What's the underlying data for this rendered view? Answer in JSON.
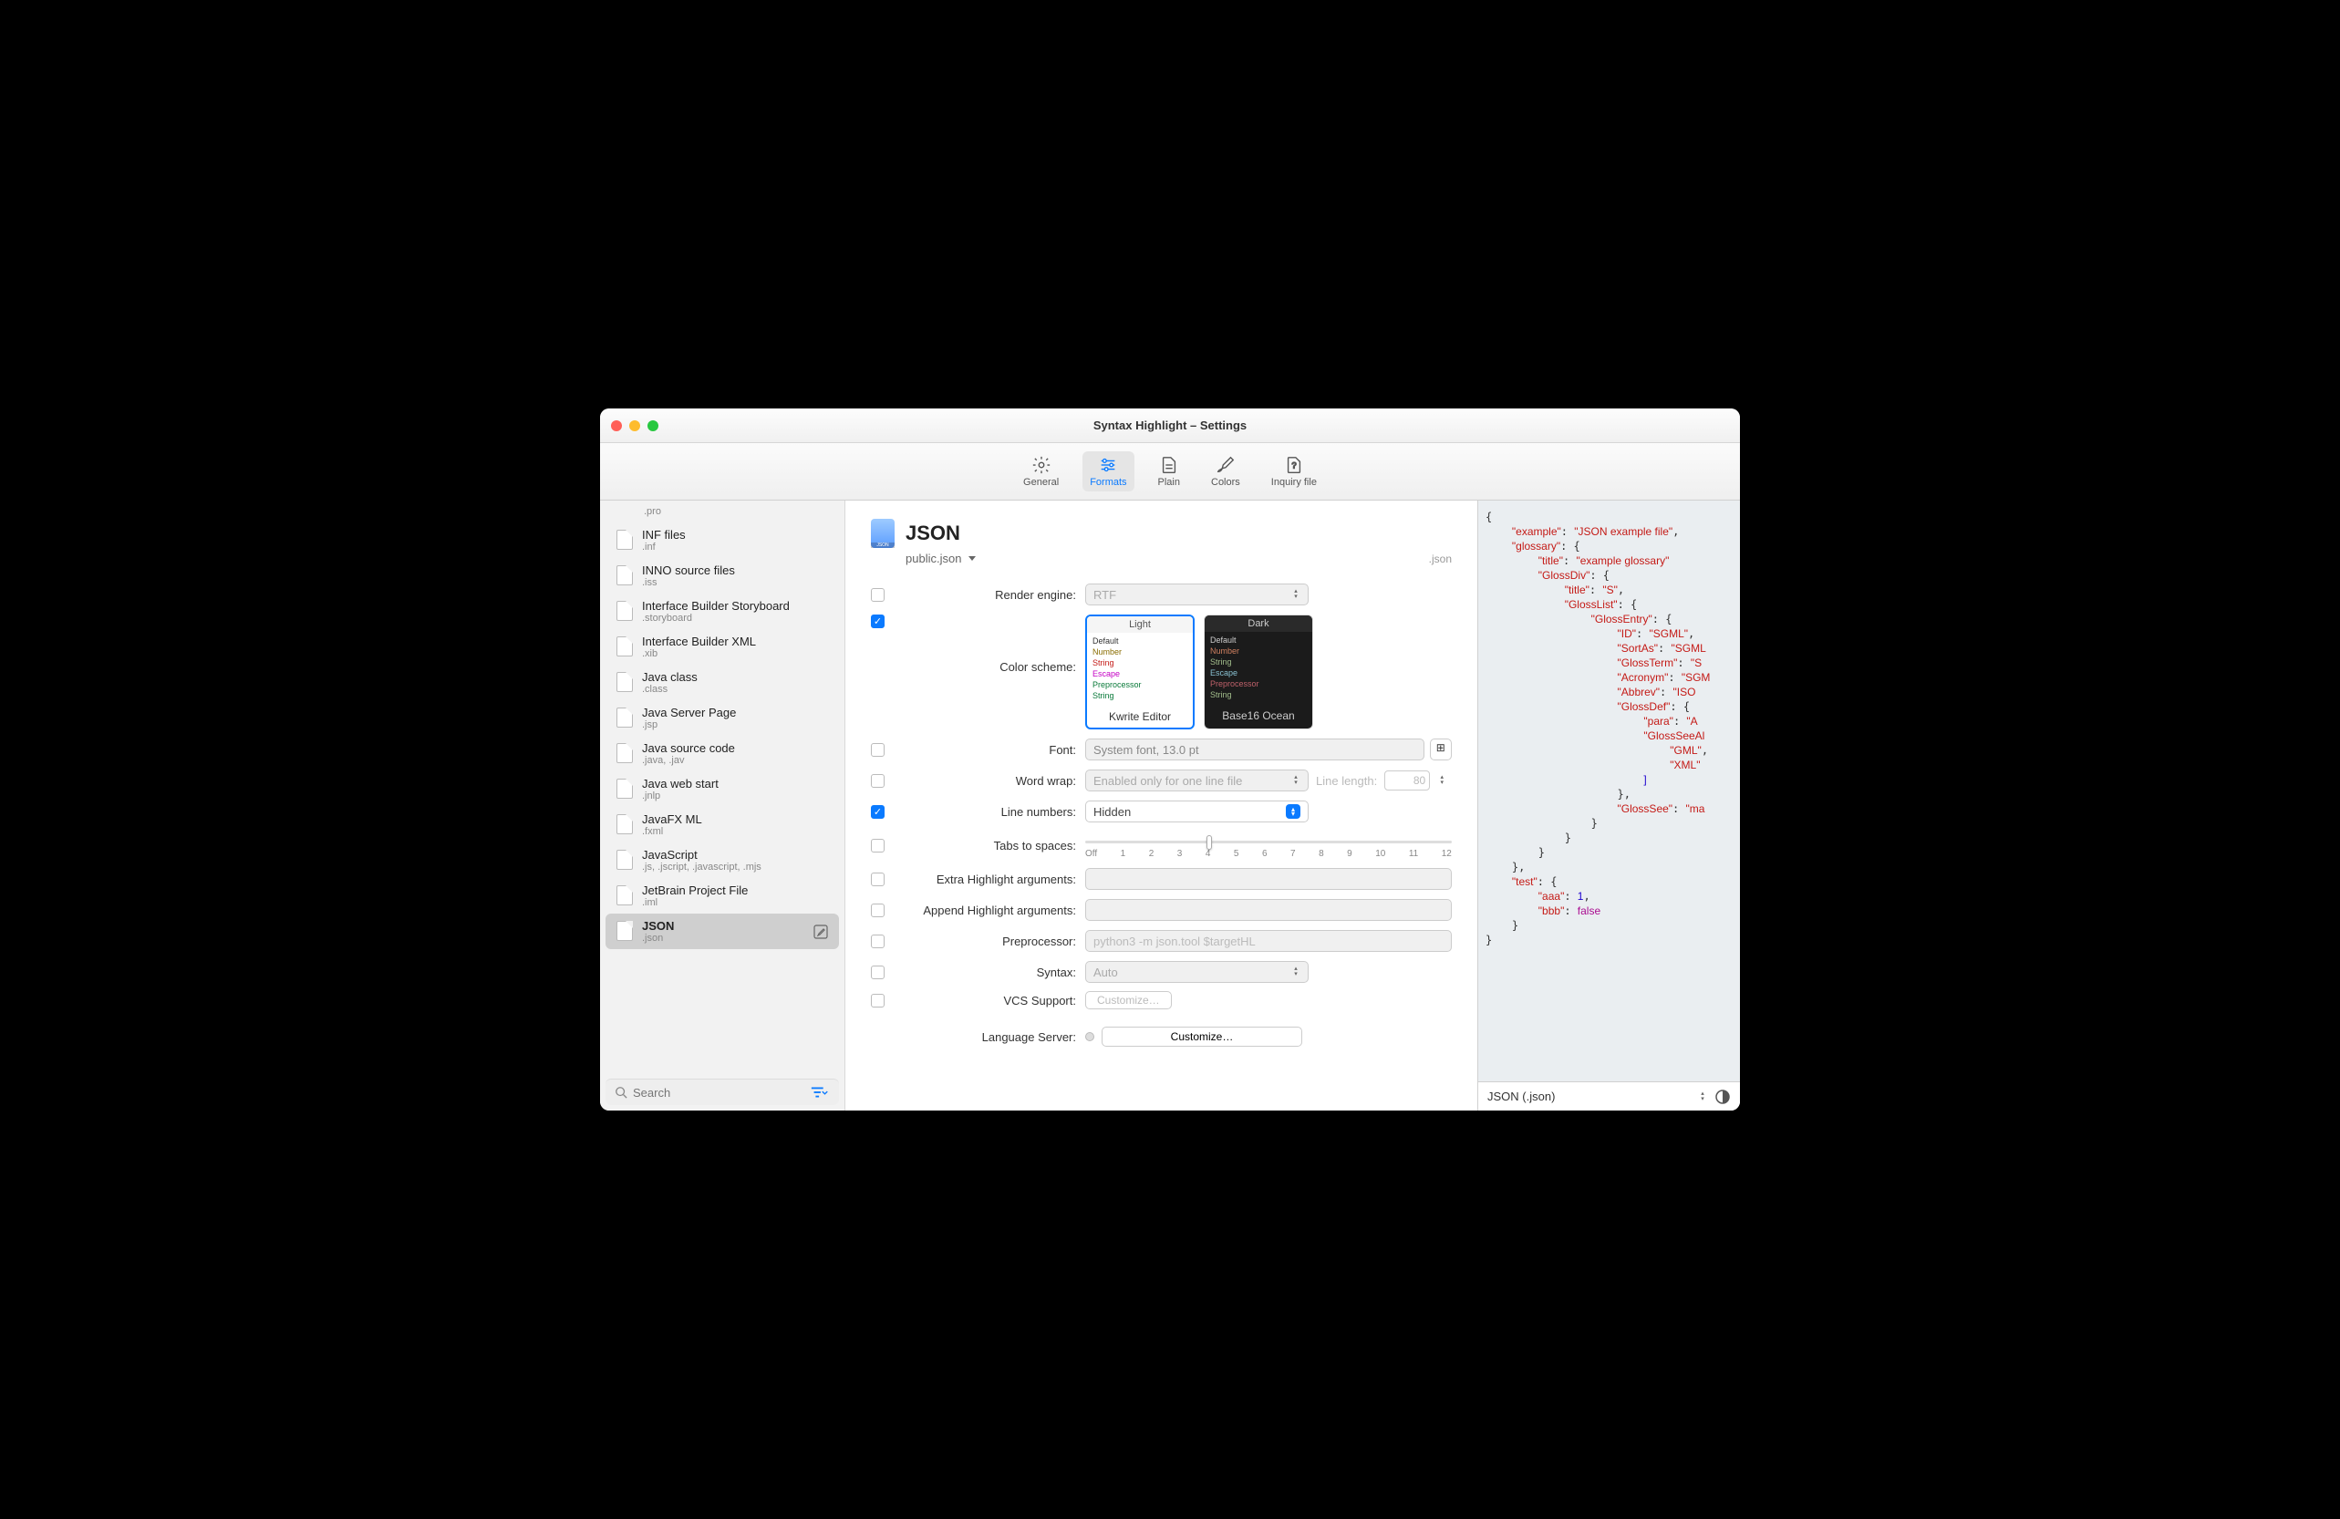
{
  "window": {
    "title": "Syntax Highlight – Settings"
  },
  "toolbar": {
    "items": [
      {
        "label": "General",
        "icon": "gear-icon"
      },
      {
        "label": "Formats",
        "icon": "sliders-icon",
        "active": true
      },
      {
        "label": "Plain",
        "icon": "document-icon"
      },
      {
        "label": "Colors",
        "icon": "brush-icon"
      },
      {
        "label": "Inquiry file",
        "icon": "file-question-icon"
      }
    ]
  },
  "sidebar": {
    "first_ext": ".pro",
    "items": [
      {
        "name": "INF files",
        "ext": ".inf"
      },
      {
        "name": "INNO source files",
        "ext": ".iss"
      },
      {
        "name": "Interface Builder Storyboard",
        "ext": ".storyboard"
      },
      {
        "name": "Interface Builder XML",
        "ext": ".xib"
      },
      {
        "name": "Java class",
        "ext": ".class"
      },
      {
        "name": "Java Server Page",
        "ext": ".jsp"
      },
      {
        "name": "Java source code",
        "ext": ".java, .jav"
      },
      {
        "name": "Java web start",
        "ext": ".jnlp"
      },
      {
        "name": "JavaFX ML",
        "ext": ".fxml"
      },
      {
        "name": "JavaScript",
        "ext": ".js, .jscript, .javascript, .mjs"
      },
      {
        "name": "JetBrain Project File",
        "ext": ".iml"
      },
      {
        "name": "JSON",
        "ext": ".json",
        "selected": true
      }
    ],
    "search_placeholder": "Search"
  },
  "main": {
    "title": "JSON",
    "file": "public.json",
    "ext": ".json",
    "labels": {
      "render_engine": "Render engine:",
      "color_scheme": "Color scheme:",
      "font": "Font:",
      "word_wrap": "Word wrap:",
      "line_length": "Line length:",
      "line_numbers": "Line numbers:",
      "tabs_to_spaces": "Tabs to spaces:",
      "extra_args": "Extra Highlight arguments:",
      "append_args": "Append Highlight arguments:",
      "preprocessor": "Preprocessor:",
      "syntax": "Syntax:",
      "vcs": "VCS Support:",
      "lang_server": "Language Server:"
    },
    "values": {
      "render_engine": "RTF",
      "font": "System font, 13.0 pt",
      "word_wrap": "Enabled only for one line file",
      "line_length": "80",
      "line_numbers": "Hidden",
      "preprocessor_placeholder": "python3 -m json.tool $targetHL",
      "syntax": "Auto",
      "vcs_button": "Customize…",
      "ls_button": "Customize…"
    },
    "themes": {
      "light_label": "Light",
      "dark_label": "Dark",
      "light_name": "Kwrite Editor",
      "dark_name": "Base16 Ocean",
      "preview_lines": [
        "Default",
        "Number",
        "String",
        "Escape",
        "Preprocessor",
        "String"
      ]
    },
    "slider_ticks": [
      "Off",
      "1",
      "2",
      "3",
      "4",
      "5",
      "6",
      "7",
      "8",
      "9",
      "10",
      "11",
      "12"
    ]
  },
  "preview": {
    "language_select": "JSON (.json)"
  }
}
